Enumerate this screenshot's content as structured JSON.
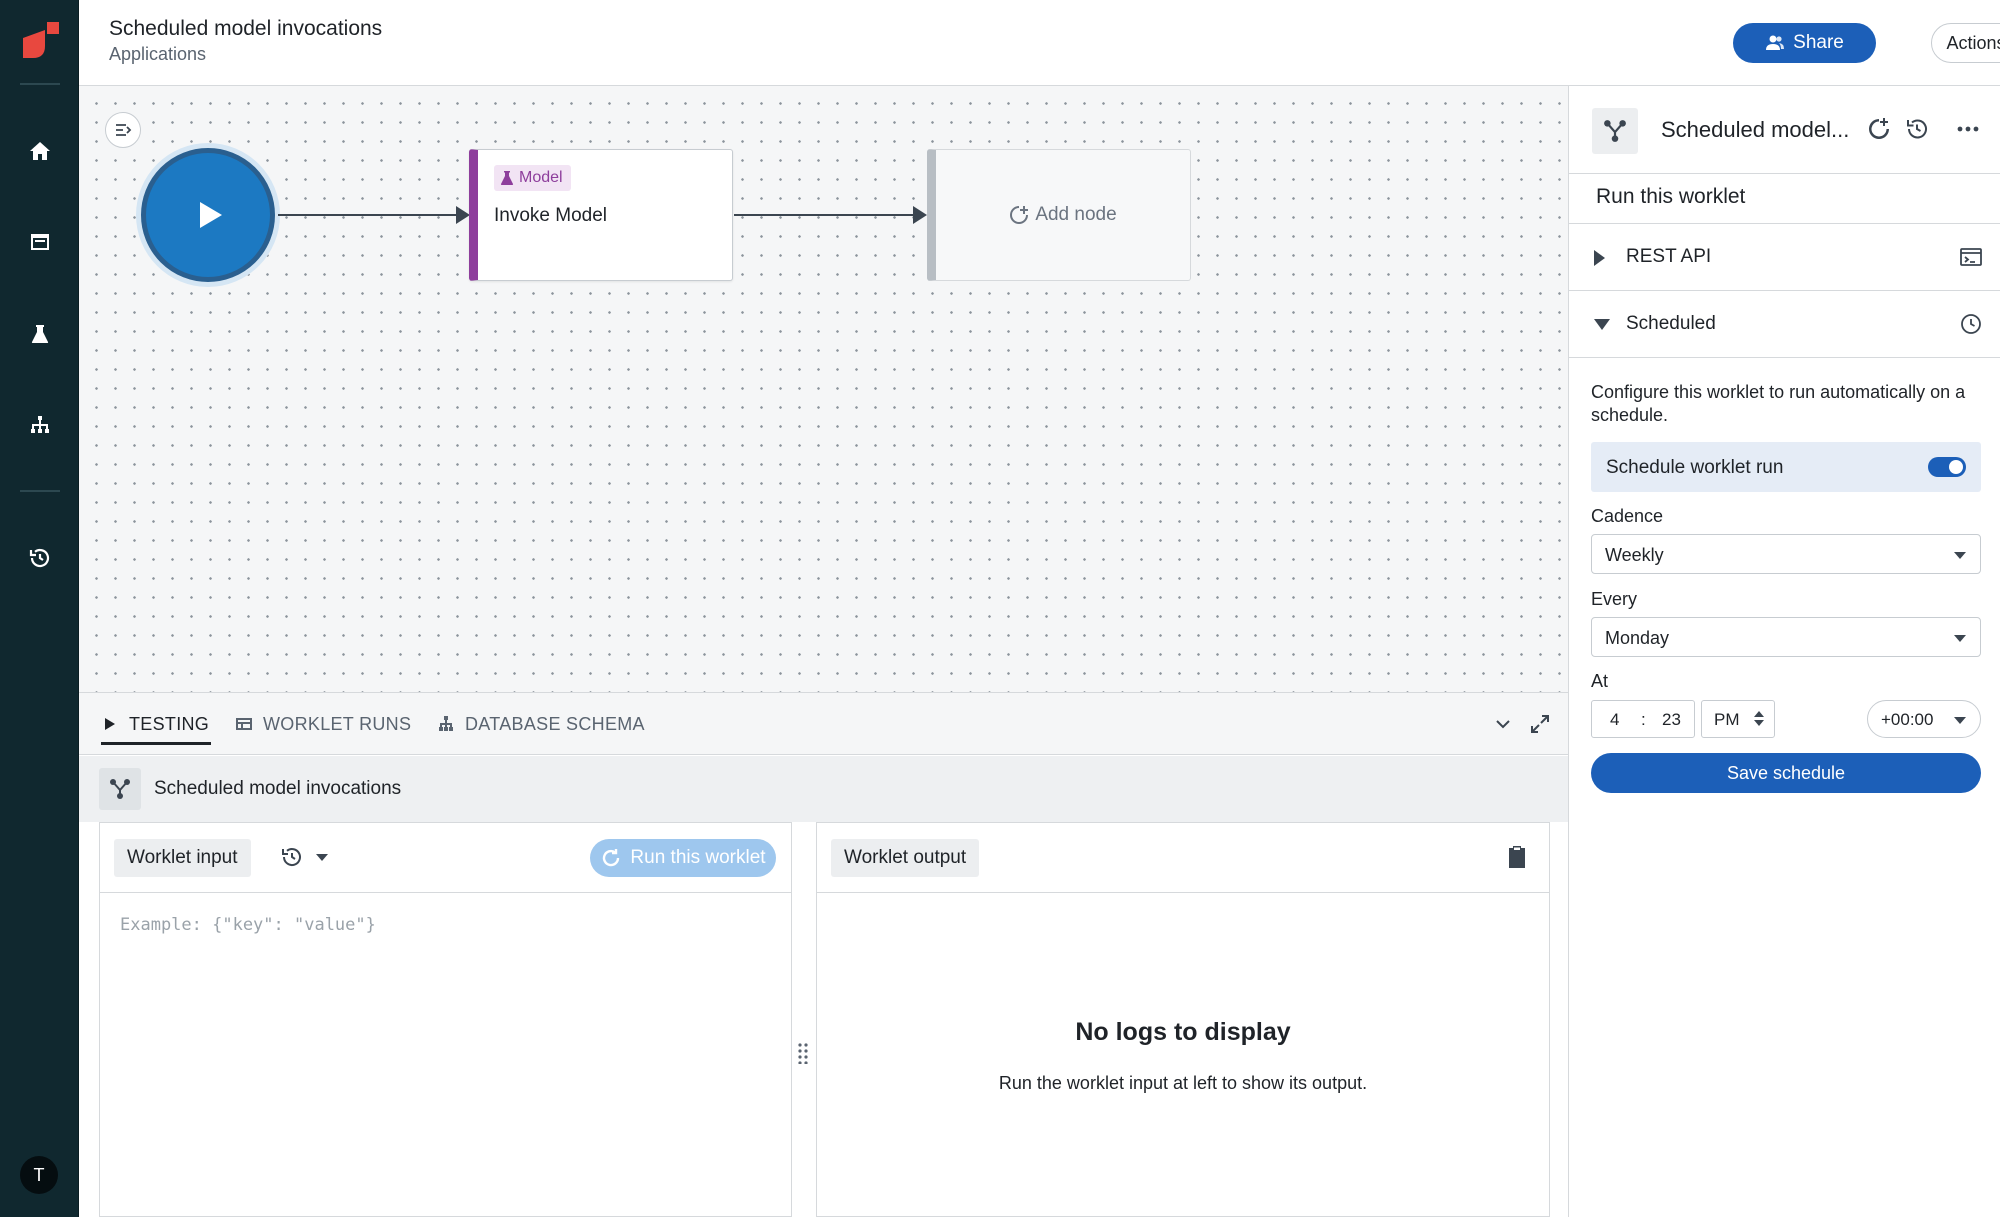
{
  "app": {
    "avatar_initial": "T",
    "brand_color": "#e8483f",
    "rail_color": "#10282f"
  },
  "rail": {
    "items": [
      {
        "icon": "home-icon"
      },
      {
        "icon": "inbox-icon"
      },
      {
        "icon": "flask-icon"
      },
      {
        "icon": "hierarchy-icon"
      },
      {
        "icon": "history-icon"
      }
    ]
  },
  "header": {
    "title": "Scheduled model invocations",
    "subtitle": "Applications",
    "share_label": "Share",
    "actions_label": "Actions"
  },
  "canvas": {
    "model_node": {
      "badge": "Model",
      "name": "Invoke Model",
      "accent": "#8e3e9c"
    },
    "add_node_label": "Add node"
  },
  "bottom": {
    "tabs": [
      {
        "label": "TESTING",
        "active": true
      },
      {
        "label": "WORKLET RUNS"
      },
      {
        "label": "DATABASE SCHEMA"
      }
    ],
    "worklet_name": "Scheduled model invocations",
    "input": {
      "chip": "Worklet input",
      "run_label": "Run this worklet",
      "placeholder": "Example: {\"key\": \"value\"}"
    },
    "output": {
      "chip": "Worklet output",
      "empty_title": "No logs to display",
      "empty_sub": "Run the worklet input at left to show its output."
    }
  },
  "panel": {
    "title": "Scheduled model...",
    "run_heading": "Run this worklet",
    "rest_label": "REST API",
    "scheduled_label": "Scheduled",
    "description": "Configure this worklet to run automatically on a schedule.",
    "toggle_label": "Schedule worklet run",
    "toggle_on": true,
    "cadence_label": "Cadence",
    "cadence_value": "Weekly",
    "every_label": "Every",
    "every_value": "Monday",
    "at_label": "At",
    "hour": "4",
    "separator": ":",
    "minute": "23",
    "ampm": "PM",
    "timezone": "+00:00",
    "save_label": "Save schedule",
    "accent": "#1c5fb8"
  }
}
